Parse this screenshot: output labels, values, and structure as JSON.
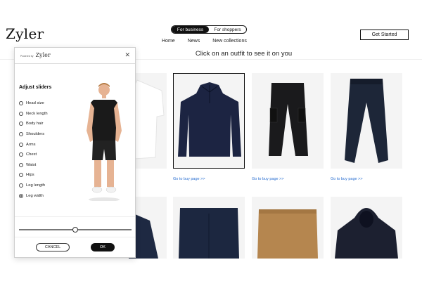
{
  "header": {
    "logo": "Zyler",
    "toggle": {
      "business": "For business",
      "shoppers": "For shoppers"
    },
    "nav": [
      "Home",
      "News",
      "New collections"
    ],
    "cta": "Get Started",
    "hint": "Click on an outfit to see it on you"
  },
  "products": {
    "buy_link": "Go to buy page >>",
    "items": [
      {
        "name": "white-shirt"
      },
      {
        "name": "navy-quarter-zip-sweater",
        "selected": true
      },
      {
        "name": "black-cargo-pants"
      },
      {
        "name": "navy-joggers"
      },
      {
        "name": "navy-jacket"
      },
      {
        "name": "navy-chinos"
      },
      {
        "name": "tan-chinos"
      },
      {
        "name": "navy-hoodie"
      }
    ]
  },
  "modal": {
    "powered_by": "Powered by",
    "brand": "Zyler",
    "title": "Adjust sliders",
    "options": [
      {
        "label": "Head size",
        "checked": false
      },
      {
        "label": "Neck length",
        "checked": false
      },
      {
        "label": "Body hair",
        "checked": false
      },
      {
        "label": "Shoulders",
        "checked": false
      },
      {
        "label": "Arms",
        "checked": false
      },
      {
        "label": "Chest",
        "checked": false
      },
      {
        "label": "Waist",
        "checked": false
      },
      {
        "label": "Hips",
        "checked": false
      },
      {
        "label": "Leg length",
        "checked": false
      },
      {
        "label": "Leg width",
        "checked": true
      }
    ],
    "slider_value": 0.5,
    "cancel": "CANCEL",
    "ok": "OK"
  },
  "colors": {
    "accent_link": "#2a6fd1",
    "dark": "#111111",
    "card_bg": "#f4f4f4"
  }
}
